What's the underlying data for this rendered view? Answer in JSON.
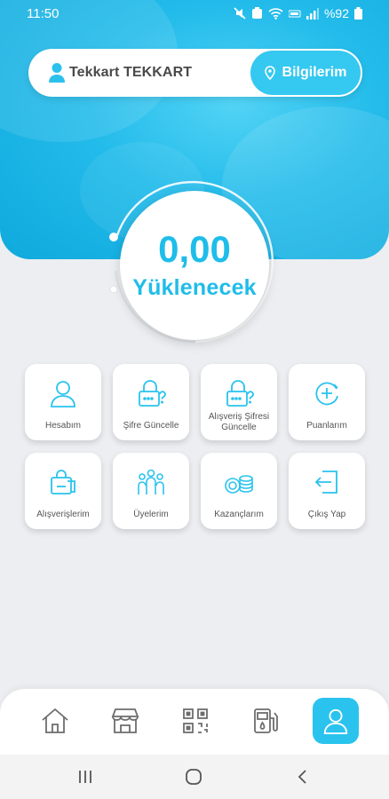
{
  "status": {
    "time": "11:50",
    "battery": "%92"
  },
  "user": {
    "name": "Tekkart TEKKART",
    "info_button": "Bilgilerim"
  },
  "balance": {
    "amount": "0,00",
    "label": "Yüklenecek"
  },
  "menu": [
    {
      "label": "Hesabım",
      "icon": "user-icon"
    },
    {
      "label": "Şifre Güncelle",
      "icon": "password-lock-icon"
    },
    {
      "label": "Alışveriş Şifresi Güncelle",
      "icon": "shopping-password-lock-icon"
    },
    {
      "label": "Puanlarım",
      "icon": "points-plus-icon"
    },
    {
      "label": "Alışverişlerim",
      "icon": "shopping-bag-icon"
    },
    {
      "label": "Üyelerim",
      "icon": "members-group-icon"
    },
    {
      "label": "Kazançlarım",
      "icon": "coins-icon"
    },
    {
      "label": "Çıkış Yap",
      "icon": "logout-icon"
    }
  ],
  "bottom_nav": [
    "home-icon",
    "store-icon",
    "qr-code-icon",
    "fuel-pump-icon",
    "profile-icon"
  ],
  "colors": {
    "accent": "#29c3ee",
    "text": "#555555"
  }
}
